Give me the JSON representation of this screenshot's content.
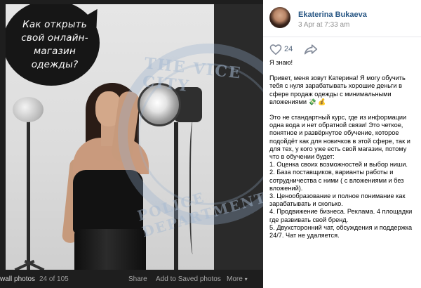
{
  "viewer": {
    "bubble_text": "Как открыть свой онлайн-магазин одежды?",
    "watermark_top": "THE VICE CITY",
    "watermark_bottom": "POLICE DEPARTMENT",
    "album_label": "wall photos",
    "counter": "24 of 105",
    "share_label": "Share",
    "save_label": "Add to Saved photos",
    "more_label": "More"
  },
  "post": {
    "author": "Ekaterina Bukaeva",
    "date": "3 Apr at 7:33 am",
    "likes": "24",
    "line_1": "Я знаю!",
    "para_2": "Привет, меня зовут Катерина! Я могу обучить тебя с нуля зарабатывать хорошие деньги в сфере продаж одежды с минимальными вложениями",
    "para_2_emojis": "💸 💰",
    "para_3": "Это не стандартный курс, где из информации одна вода и нет обратной связи! Это четкое, понятное и развёрнутое обучение, которое подойдёт как для новичков в этой сфере, так и для тех, у кого уже есть свой магазин, потому что в обучении будет:",
    "item_1": "1. Оценка своих возможностей и выбор ниши.",
    "item_2": "2. База поставщиков, варианты работы и сотрудничества с ними ( с вложениями и без вложений).",
    "item_3": "3. Ценообразование и полное понимание как зарабатывать и сколько.",
    "item_4": "4. Продвижение бизнеса. Реклама. 4 площадки где развивать свой бренд.",
    "item_5": "5. Двухсторонний чат, обсуждения и поддержка 24/7. Чат не удаляется."
  },
  "colors": {
    "author_link": "#2a5885",
    "meta_grey": "#939393",
    "viewer_bg": "#1e1e1e"
  },
  "icons": {
    "like": "heart-outline-icon",
    "share": "share-arrow-icon",
    "more": "chevron-down-icon"
  }
}
